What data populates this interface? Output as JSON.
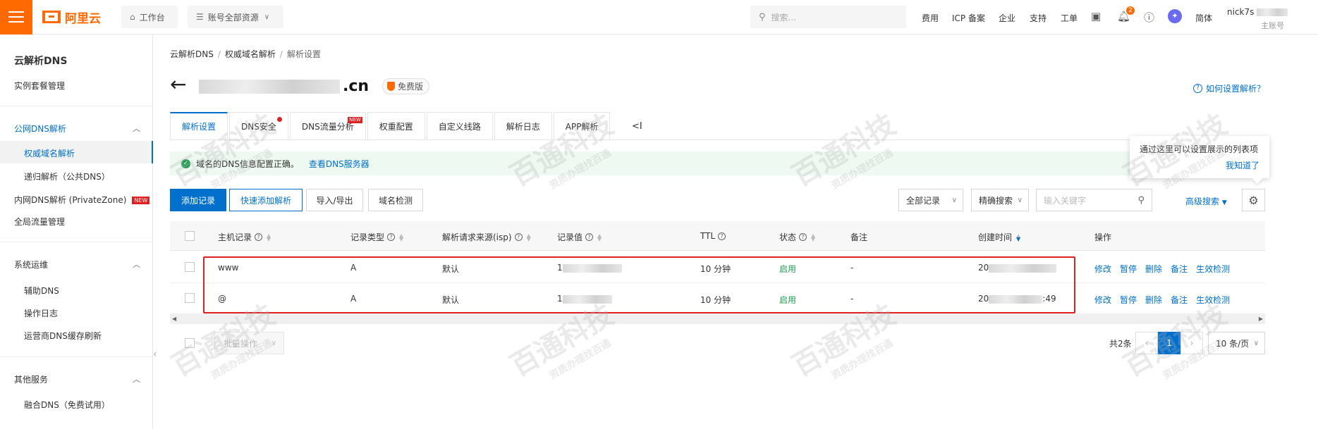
{
  "topbar": {
    "logo_text": "阿里云",
    "workbench": "工作台",
    "account_resources": "账号全部资源",
    "search_placeholder": "搜索...",
    "links": [
      "费用",
      "ICP 备案",
      "企业",
      "支持",
      "工单"
    ],
    "notification_count": "2",
    "language": "简体",
    "user_name_prefix": "nick7s",
    "user_role": "主账号",
    "accent_color": "#ff6a00"
  },
  "sidebar": {
    "title": "云解析DNS",
    "instance": "实例套餐管理",
    "group_public": "公网DNS解析",
    "authoritative": "权威域名解析",
    "recursive": "递归解析（公共DNS）",
    "private_zone": "内网DNS解析 (PrivateZone)",
    "new_tag": "NEW",
    "global_traffic": "全局流量管理",
    "group_ops": "系统运维",
    "aux_dns": "辅助DNS",
    "op_log": "操作日志",
    "isp_refresh": "运营商DNS缓存刷新",
    "group_other": "其他服务",
    "fusion_dns": "融合DNS（免费试用）"
  },
  "breadcrumb": [
    "云解析DNS",
    "权威域名解析",
    "解析设置"
  ],
  "header": {
    "domain_suffix": ".cn",
    "edition": "免费版",
    "help": "如何设置解析？"
  },
  "tabs": [
    {
      "label": "解析设置",
      "active": true
    },
    {
      "label": "DNS安全",
      "dot": true
    },
    {
      "label": "DNS流量分析",
      "new": "NEW"
    },
    {
      "label": "权重配置"
    },
    {
      "label": "自定义线路"
    },
    {
      "label": "解析日志"
    },
    {
      "label": "APP解析"
    }
  ],
  "tabs_more": "<I",
  "notice": {
    "text": "域名的DNS信息配置正确。",
    "link": "查看DNS服务器"
  },
  "tooltip": {
    "text": "通过这里可以设置展示的列表项",
    "ok": "我知道了"
  },
  "toolbar": {
    "add": "添加记录",
    "quick_add": "快速添加解析",
    "import_export": "导入/导出",
    "check": "域名检测",
    "all_records": "全部记录",
    "exact_search": "精确搜索",
    "keyword_placeholder": "输入关键字",
    "advanced": "高级搜索"
  },
  "table": {
    "headers": [
      "主机记录",
      "记录类型",
      "解析请求来源(isp)",
      "记录值",
      "TTL",
      "状态",
      "备注",
      "创建时间",
      "操作"
    ],
    "rows": [
      {
        "host": "www",
        "type": "A",
        "isp": "默认",
        "value_prefix": "1",
        "ttl": "10 分钟",
        "status": "启用",
        "remark": "-",
        "created_prefix": "20",
        "created_suffix": ""
      },
      {
        "host": "@",
        "type": "A",
        "isp": "默认",
        "value_prefix": "1",
        "ttl": "10 分钟",
        "status": "启用",
        "remark": "-",
        "created_prefix": "20",
        "created_suffix": ":49"
      }
    ],
    "ops": [
      "修改",
      "暂停",
      "删除",
      "备注",
      "生效检测"
    ]
  },
  "footer": {
    "bulk": "批量操作",
    "total": "共2条",
    "page": "1",
    "page_size": "10 条/页"
  },
  "watermark": {
    "brand": "百通科技",
    "slogan": "资质办理找百通"
  }
}
